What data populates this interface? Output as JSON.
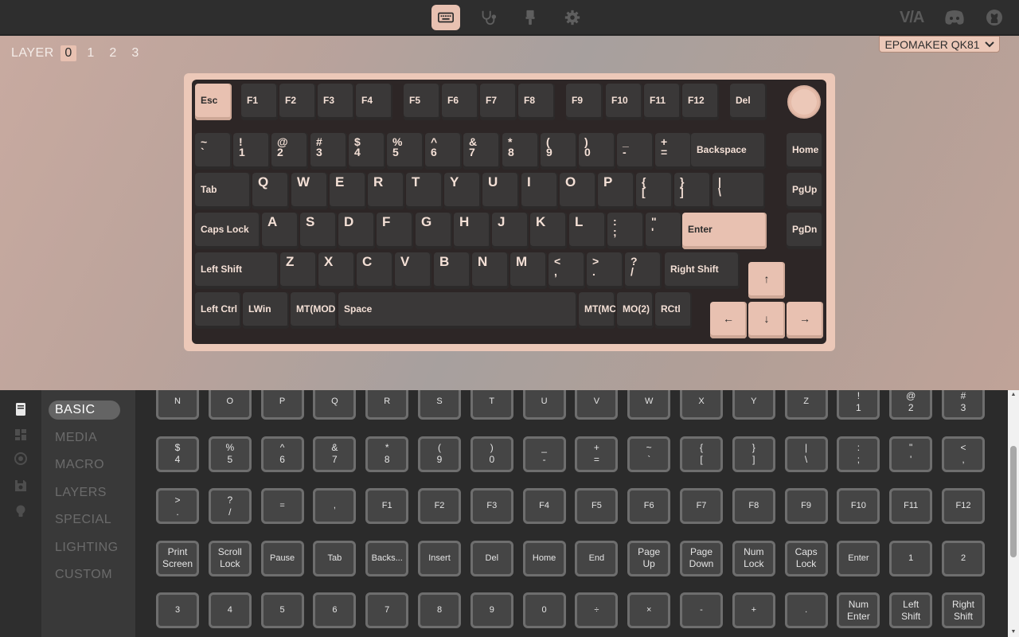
{
  "topbar": {
    "nav": [
      {
        "name": "keyboard-icon",
        "active": true
      },
      {
        "name": "stethoscope-icon",
        "active": false
      },
      {
        "name": "paintbrush-icon",
        "active": false
      },
      {
        "name": "gear-icon",
        "active": false
      }
    ],
    "brand": "V/A",
    "links": [
      "discord-icon",
      "github-icon"
    ]
  },
  "layers": {
    "label": "LAYER",
    "items": [
      "0",
      "1",
      "2",
      "3"
    ],
    "active": "0"
  },
  "device": {
    "name": "EPOMAKER QK81"
  },
  "keyboard": {
    "rows": [
      [
        {
          "t": "Esc",
          "a": true
        },
        {
          "t": "F1"
        },
        {
          "t": "F2"
        },
        {
          "t": "F3"
        },
        {
          "t": "F4"
        },
        {
          "t": "F5"
        },
        {
          "t": "F6"
        },
        {
          "t": "F7"
        },
        {
          "t": "F8"
        },
        {
          "t": "F9"
        },
        {
          "t": "F10"
        },
        {
          "t": "F11"
        },
        {
          "t": "F12"
        },
        {
          "t": "Del"
        }
      ],
      [
        {
          "u": "~",
          "l": "`"
        },
        {
          "u": "!",
          "l": "1"
        },
        {
          "u": "@",
          "l": "2"
        },
        {
          "u": "#",
          "l": "3"
        },
        {
          "u": "$",
          "l": "4"
        },
        {
          "u": "%",
          "l": "5"
        },
        {
          "u": "^",
          "l": "6"
        },
        {
          "u": "&",
          "l": "7"
        },
        {
          "u": "*",
          "l": "8"
        },
        {
          "u": "(",
          "l": "9"
        },
        {
          "u": ")",
          "l": "0"
        },
        {
          "u": "_",
          "l": "-"
        },
        {
          "u": "+",
          "l": "="
        },
        {
          "t": "Backspace"
        },
        {
          "t": "Home"
        }
      ],
      [
        {
          "t": "Tab"
        },
        {
          "b": "Q"
        },
        {
          "b": "W"
        },
        {
          "b": "E"
        },
        {
          "b": "R"
        },
        {
          "b": "T"
        },
        {
          "b": "Y"
        },
        {
          "b": "U"
        },
        {
          "b": "I"
        },
        {
          "b": "O"
        },
        {
          "b": "P"
        },
        {
          "u": "{",
          "l": "["
        },
        {
          "u": "}",
          "l": "]"
        },
        {
          "u": "|",
          "l": "\\"
        },
        {
          "t": "PgUp"
        }
      ],
      [
        {
          "t": "Caps Lock"
        },
        {
          "b": "A"
        },
        {
          "b": "S"
        },
        {
          "b": "D"
        },
        {
          "b": "F"
        },
        {
          "b": "G"
        },
        {
          "b": "H"
        },
        {
          "b": "J"
        },
        {
          "b": "K"
        },
        {
          "b": "L"
        },
        {
          "u": ":",
          "l": ";"
        },
        {
          "u": "\"",
          "l": "'"
        },
        {
          "t": "Enter",
          "a": true
        },
        {
          "t": "PgDn"
        }
      ],
      [
        {
          "t": "Left Shift"
        },
        {
          "b": "Z"
        },
        {
          "b": "X"
        },
        {
          "b": "C"
        },
        {
          "b": "V"
        },
        {
          "b": "B"
        },
        {
          "b": "N"
        },
        {
          "b": "M"
        },
        {
          "u": "<",
          "l": ","
        },
        {
          "u": ">",
          "l": "."
        },
        {
          "u": "?",
          "l": "/"
        },
        {
          "t": "Right Shift"
        },
        {
          "c": "↑",
          "a": true
        }
      ],
      [
        {
          "t": "Left Ctrl"
        },
        {
          "t": "LWin"
        },
        {
          "t": "MT(MOD"
        },
        {
          "t": "Space"
        },
        {
          "t": "MT(MC"
        },
        {
          "t": "MO(2)"
        },
        {
          "t": "RCtl"
        },
        {
          "c": "←",
          "a": true
        },
        {
          "c": "↓",
          "a": true
        },
        {
          "c": "→",
          "a": true
        }
      ]
    ]
  },
  "categories": {
    "items": [
      "BASIC",
      "MEDIA",
      "MACRO",
      "LAYERS",
      "SPECIAL",
      "LIGHTING",
      "CUSTOM"
    ],
    "active": "BASIC"
  },
  "sidebar_icons": [
    "book-icon",
    "grid-icon",
    "record-icon",
    "save-icon",
    "lightbulb-icon"
  ],
  "keycodes": [
    [
      [
        "N"
      ],
      [
        "O"
      ],
      [
        "P"
      ],
      [
        "Q"
      ],
      [
        "R"
      ],
      [
        "S"
      ],
      [
        "T"
      ],
      [
        "U"
      ],
      [
        "V"
      ],
      [
        "W"
      ],
      [
        "X"
      ],
      [
        "Y"
      ],
      [
        "Z"
      ],
      [
        "!",
        "1"
      ],
      [
        "@",
        "2"
      ],
      [
        "#",
        "3"
      ]
    ],
    [
      [
        "$",
        "4"
      ],
      [
        "%",
        "5"
      ],
      [
        "^",
        "6"
      ],
      [
        "&",
        "7"
      ],
      [
        "*",
        "8"
      ],
      [
        "(",
        "9"
      ],
      [
        ")",
        "0"
      ],
      [
        "_",
        "-"
      ],
      [
        "+",
        "="
      ],
      [
        "~",
        "`"
      ],
      [
        "{",
        "["
      ],
      [
        "}",
        "]"
      ],
      [
        "|",
        "\\"
      ],
      [
        ":",
        ";"
      ],
      [
        "\"",
        "'"
      ],
      [
        "<",
        ","
      ]
    ],
    [
      [
        ">",
        "."
      ],
      [
        "?",
        "/"
      ],
      [
        "="
      ],
      [
        ","
      ],
      [
        "F1"
      ],
      [
        "F2"
      ],
      [
        "F3"
      ],
      [
        "F4"
      ],
      [
        "F5"
      ],
      [
        "F6"
      ],
      [
        "F7"
      ],
      [
        "F8"
      ],
      [
        "F9"
      ],
      [
        "F10"
      ],
      [
        "F11"
      ],
      [
        "F12"
      ]
    ],
    [
      [
        "Print",
        "Screen"
      ],
      [
        "Scroll",
        "Lock"
      ],
      [
        "Pause"
      ],
      [
        "Tab"
      ],
      [
        "Backs..."
      ],
      [
        "Insert"
      ],
      [
        "Del"
      ],
      [
        "Home"
      ],
      [
        "End"
      ],
      [
        "Page",
        "Up"
      ],
      [
        "Page",
        "Down"
      ],
      [
        "Num",
        "Lock"
      ],
      [
        "Caps",
        "Lock"
      ],
      [
        "Enter"
      ],
      [
        "1"
      ],
      [
        "2"
      ]
    ],
    [
      [
        "3"
      ],
      [
        "4"
      ],
      [
        "5"
      ],
      [
        "6"
      ],
      [
        "7"
      ],
      [
        "8"
      ],
      [
        "9"
      ],
      [
        "0"
      ],
      [
        "÷"
      ],
      [
        "×"
      ],
      [
        "-"
      ],
      [
        "+"
      ],
      [
        "."
      ],
      [
        "Num",
        "Enter"
      ],
      [
        "Left",
        "Shift"
      ],
      [
        "Right",
        "Shift"
      ]
    ]
  ],
  "colors": {
    "accent": "#e8c1b1",
    "keycap": "#3a3838",
    "plate": "#2d2626"
  }
}
